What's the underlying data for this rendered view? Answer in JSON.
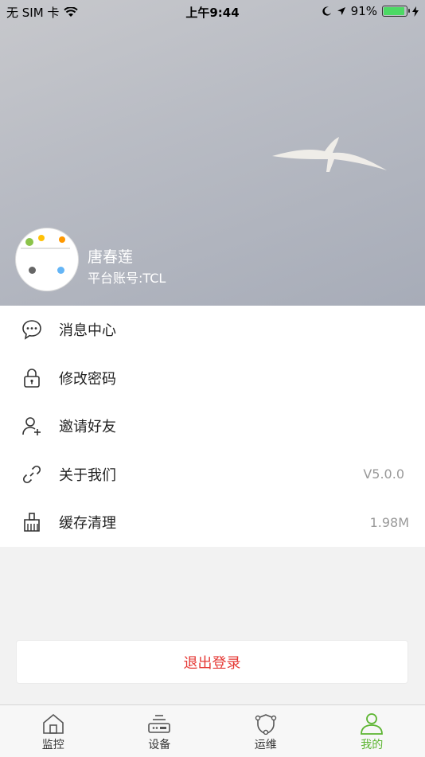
{
  "status_bar": {
    "carrier": "无 SIM 卡",
    "time": "上午9:44",
    "battery": "91%"
  },
  "profile": {
    "name": "唐春莲",
    "account": "平台账号:TCL"
  },
  "menu": [
    {
      "label": "消息中心",
      "value": "",
      "icon": "message-icon"
    },
    {
      "label": "修改密码",
      "value": "",
      "icon": "lock-icon"
    },
    {
      "label": "邀请好友",
      "value": "",
      "icon": "add-user-icon"
    },
    {
      "label": "关于我们",
      "value": "V5.0.0",
      "icon": "link-icon"
    },
    {
      "label": "缓存清理",
      "value": "1.98M",
      "icon": "broom-icon"
    }
  ],
  "logout_label": "退出登录",
  "tabs": [
    {
      "label": "监控",
      "icon": "home-icon",
      "active": false
    },
    {
      "label": "设备",
      "icon": "device-icon",
      "active": false
    },
    {
      "label": "运维",
      "icon": "maintenance-icon",
      "active": false
    },
    {
      "label": "我的",
      "icon": "profile-icon",
      "active": true
    }
  ],
  "colors": {
    "accent": "#5cb531",
    "logout": "#e53935"
  }
}
